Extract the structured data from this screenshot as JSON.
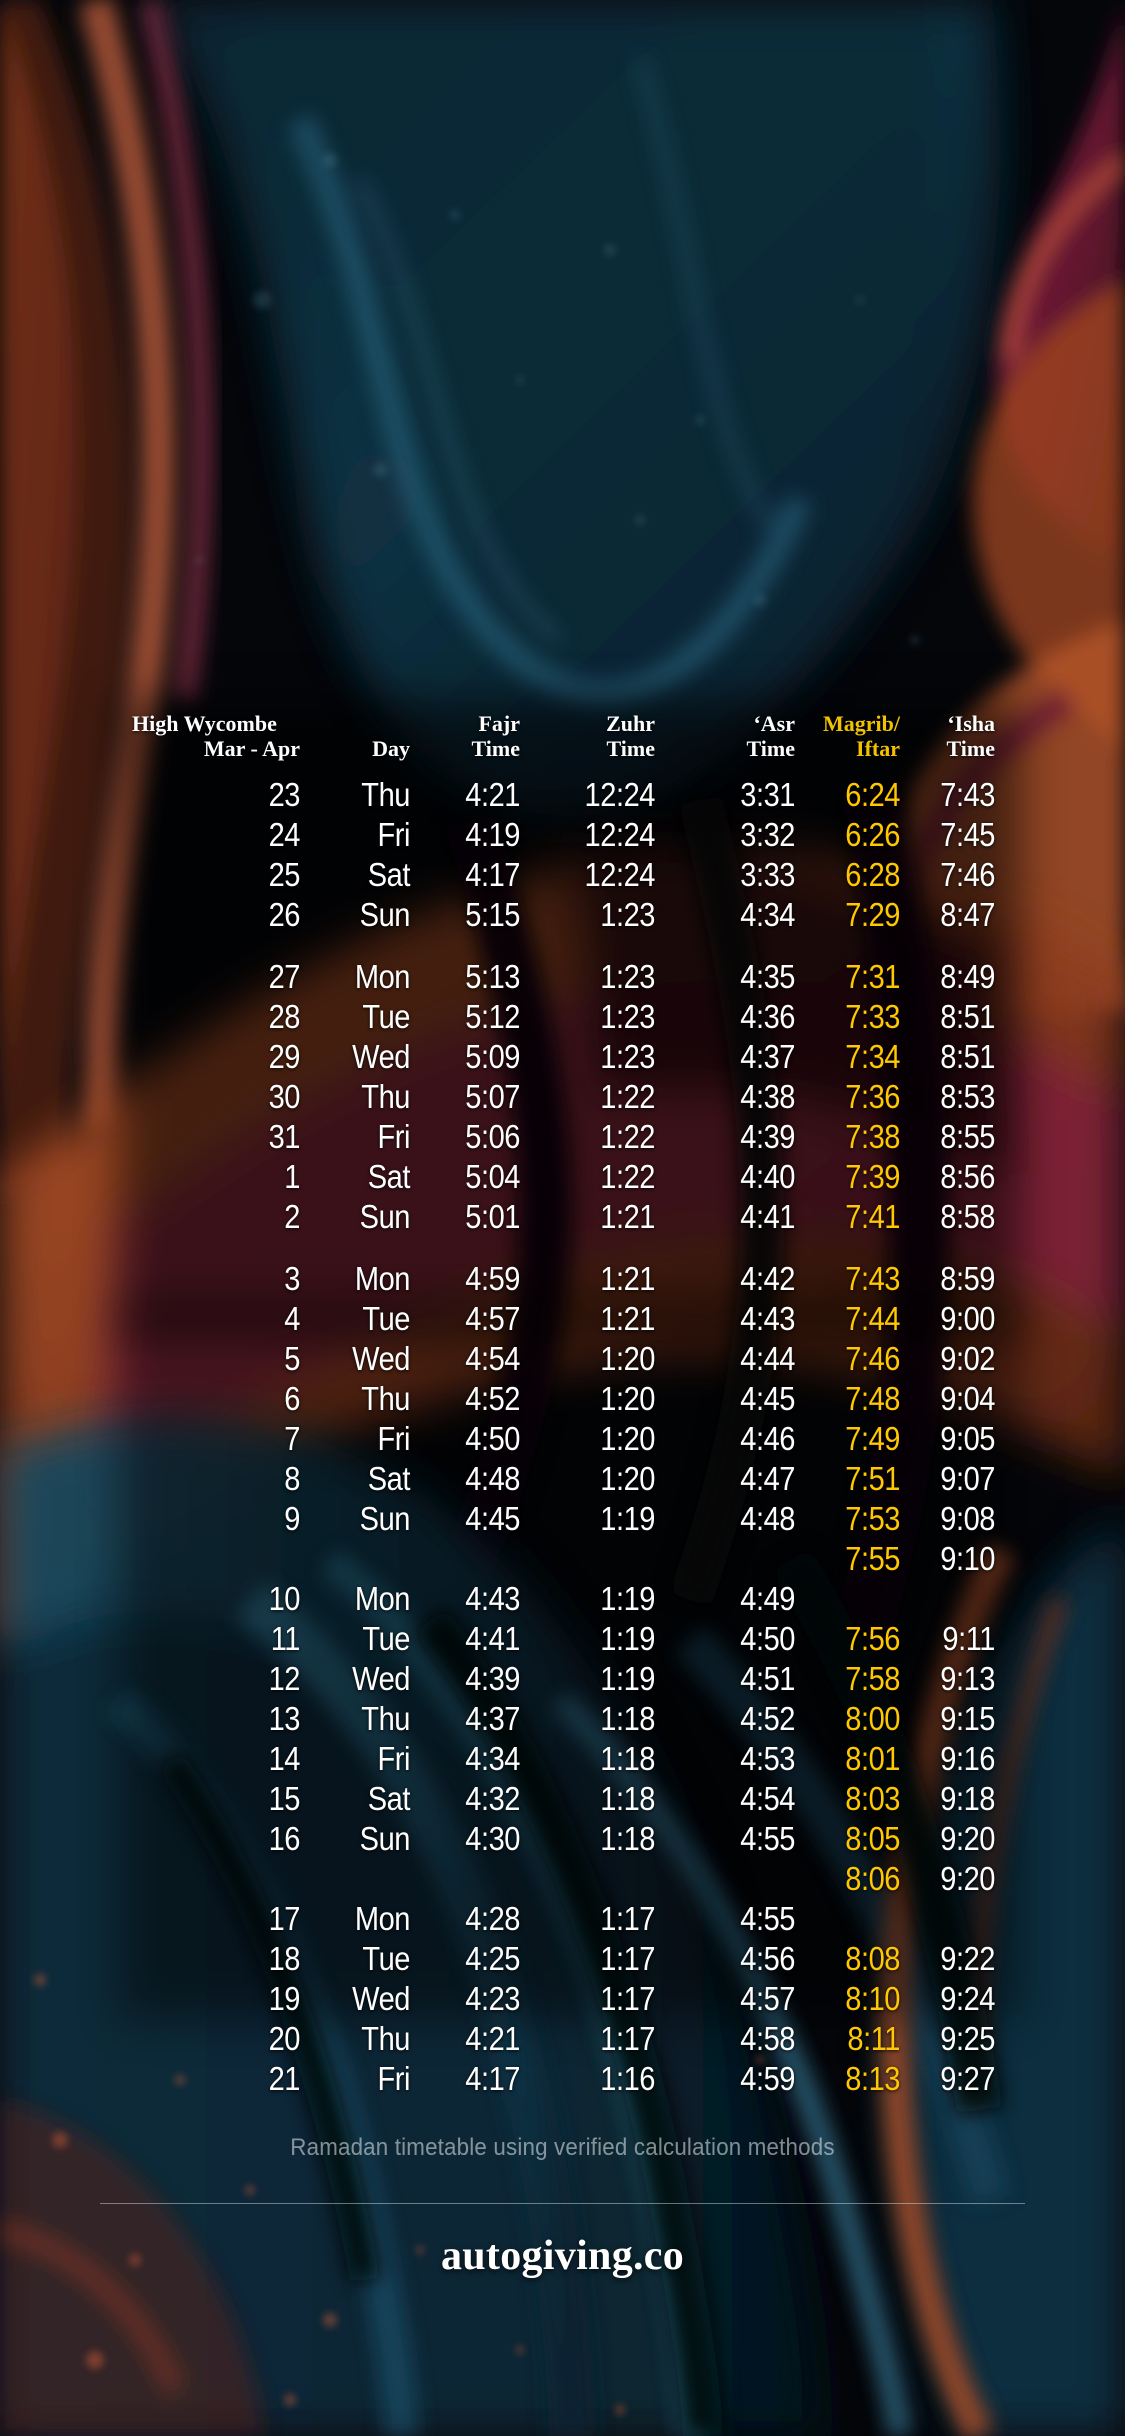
{
  "colors": {
    "magrib_accent": "#FFC800",
    "header_magrib": "#F2C200",
    "text": "#FFFFFF",
    "footnote": "rgba(232,238,242,0.55)",
    "background_base": "#04060A"
  },
  "header": {
    "location_line1": "High Wycombe",
    "location_line2": "Mar - Apr",
    "columns": [
      {
        "line1": "Day",
        "line2": ""
      },
      {
        "line1": "Fajr",
        "line2": "Time"
      },
      {
        "line1": "Zuhr",
        "line2": "Time"
      },
      {
        "line1": "‘Asr",
        "line2": "Time"
      },
      {
        "line1": "Magrib/",
        "line2": "Iftar"
      },
      {
        "line1": "‘Isha",
        "line2": "Time"
      }
    ]
  },
  "rows": [
    {
      "date": "23",
      "day": "Thu",
      "fajr": "4:21",
      "zuhr": "12:24",
      "asr": "3:31",
      "magrib": "6:24",
      "isha": "7:43"
    },
    {
      "date": "24",
      "day": "Fri",
      "fajr": "4:19",
      "zuhr": "12:24",
      "asr": "3:32",
      "magrib": "6:26",
      "isha": "7:45"
    },
    {
      "date": "25",
      "day": "Sat",
      "fajr": "4:17",
      "zuhr": "12:24",
      "asr": "3:33",
      "magrib": "6:28",
      "isha": "7:46"
    },
    {
      "date": "26",
      "day": "Sun",
      "fajr": "5:15",
      "zuhr": "1:23",
      "asr": "4:34",
      "magrib": "7:29",
      "isha": "8:47"
    },
    {
      "spacer": true
    },
    {
      "date": "27",
      "day": "Mon",
      "fajr": "5:13",
      "zuhr": "1:23",
      "asr": "4:35",
      "magrib": "7:31",
      "isha": "8:49"
    },
    {
      "date": "28",
      "day": "Tue",
      "fajr": "5:12",
      "zuhr": "1:23",
      "asr": "4:36",
      "magrib": "7:33",
      "isha": "8:51"
    },
    {
      "date": "29",
      "day": "Wed",
      "fajr": "5:09",
      "zuhr": "1:23",
      "asr": "4:37",
      "magrib": "7:34",
      "isha": "8:51"
    },
    {
      "date": "30",
      "day": "Thu",
      "fajr": "5:07",
      "zuhr": "1:22",
      "asr": "4:38",
      "magrib": "7:36",
      "isha": "8:53"
    },
    {
      "date": "31",
      "day": "Fri",
      "fajr": "5:06",
      "zuhr": "1:22",
      "asr": "4:39",
      "magrib": "7:38",
      "isha": "8:55"
    },
    {
      "date": "1",
      "day": "Sat",
      "fajr": "5:04",
      "zuhr": "1:22",
      "asr": "4:40",
      "magrib": "7:39",
      "isha": "8:56"
    },
    {
      "date": "2",
      "day": "Sun",
      "fajr": "5:01",
      "zuhr": "1:21",
      "asr": "4:41",
      "magrib": "7:41",
      "isha": "8:58"
    },
    {
      "spacer": true
    },
    {
      "date": "3",
      "day": "Mon",
      "fajr": "4:59",
      "zuhr": "1:21",
      "asr": "4:42",
      "magrib": "7:43",
      "isha": "8:59"
    },
    {
      "date": "4",
      "day": "Tue",
      "fajr": "4:57",
      "zuhr": "1:21",
      "asr": "4:43",
      "magrib": "7:44",
      "isha": "9:00"
    },
    {
      "date": "5",
      "day": "Wed",
      "fajr": "4:54",
      "zuhr": "1:20",
      "asr": "4:44",
      "magrib": "7:46",
      "isha": "9:02"
    },
    {
      "date": "6",
      "day": "Thu",
      "fajr": "4:52",
      "zuhr": "1:20",
      "asr": "4:45",
      "magrib": "7:48",
      "isha": "9:04"
    },
    {
      "date": "7",
      "day": "Fri",
      "fajr": "4:50",
      "zuhr": "1:20",
      "asr": "4:46",
      "magrib": "7:49",
      "isha": "9:05"
    },
    {
      "date": "8",
      "day": "Sat",
      "fajr": "4:48",
      "zuhr": "1:20",
      "asr": "4:47",
      "magrib": "7:51",
      "isha": "9:07"
    },
    {
      "date": "9",
      "day": "Sun",
      "fajr": "4:45",
      "zuhr": "1:19",
      "asr": "4:48",
      "magrib": "7:53",
      "isha": "9:08"
    },
    {
      "date": "",
      "day": "",
      "fajr": "",
      "zuhr": "",
      "asr": "",
      "magrib": "7:55",
      "isha": "9:10"
    },
    {
      "date": "10",
      "day": "Mon",
      "fajr": "4:43",
      "zuhr": "1:19",
      "asr": "4:49",
      "magrib": "",
      "isha": ""
    },
    {
      "date": "11",
      "day": "Tue",
      "fajr": "4:41",
      "zuhr": "1:19",
      "asr": "4:50",
      "magrib": "7:56",
      "isha": "9:11"
    },
    {
      "date": "12",
      "day": "Wed",
      "fajr": "4:39",
      "zuhr": "1:19",
      "asr": "4:51",
      "magrib": "7:58",
      "isha": "9:13"
    },
    {
      "date": "13",
      "day": "Thu",
      "fajr": "4:37",
      "zuhr": "1:18",
      "asr": "4:52",
      "magrib": "8:00",
      "isha": "9:15"
    },
    {
      "date": "14",
      "day": "Fri",
      "fajr": "4:34",
      "zuhr": "1:18",
      "asr": "4:53",
      "magrib": "8:01",
      "isha": "9:16"
    },
    {
      "date": "15",
      "day": "Sat",
      "fajr": "4:32",
      "zuhr": "1:18",
      "asr": "4:54",
      "magrib": "8:03",
      "isha": "9:18"
    },
    {
      "date": "16",
      "day": "Sun",
      "fajr": "4:30",
      "zuhr": "1:18",
      "asr": "4:55",
      "magrib": "8:05",
      "isha": "9:20"
    },
    {
      "date": "",
      "day": "",
      "fajr": "",
      "zuhr": "",
      "asr": "",
      "magrib": "8:06",
      "isha": "9:20"
    },
    {
      "date": "17",
      "day": "Mon",
      "fajr": "4:28",
      "zuhr": "1:17",
      "asr": "4:55",
      "magrib": "",
      "isha": ""
    },
    {
      "date": "18",
      "day": "Tue",
      "fajr": "4:25",
      "zuhr": "1:17",
      "asr": "4:56",
      "magrib": "8:08",
      "isha": "9:22"
    },
    {
      "date": "19",
      "day": "Wed",
      "fajr": "4:23",
      "zuhr": "1:17",
      "asr": "4:57",
      "magrib": "8:10",
      "isha": "9:24"
    },
    {
      "date": "20",
      "day": "Thu",
      "fajr": "4:21",
      "zuhr": "1:17",
      "asr": "4:58",
      "magrib": "8:11",
      "isha": "9:25"
    },
    {
      "date": "21",
      "day": "Fri",
      "fajr": "4:17",
      "zuhr": "1:16",
      "asr": "4:59",
      "magrib": "8:13",
      "isha": "9:27"
    }
  ],
  "footer": {
    "note": "Ramadan timetable using verified calculation methods",
    "brand": "autogiving.co"
  }
}
